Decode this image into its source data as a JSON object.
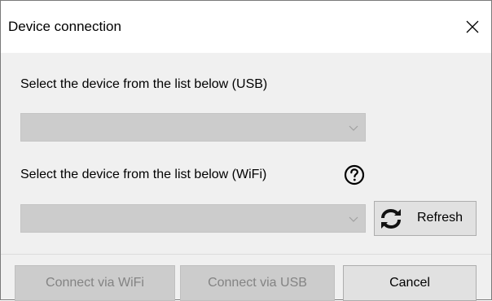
{
  "dialog": {
    "title": "Device connection",
    "close_icon": "close-icon"
  },
  "usb": {
    "label": "Select the device from the list below (USB)",
    "selected_value": "",
    "enabled": false
  },
  "wifi": {
    "label": "Select the device from the list below (WiFi)",
    "help_icon": "question-circle-icon",
    "selected_value": "",
    "enabled": false,
    "refresh_label": "Refresh",
    "refresh_icon": "refresh-icon"
  },
  "footer": {
    "connect_wifi_label": "Connect via WiFi",
    "connect_usb_label": "Connect via USB",
    "cancel_label": "Cancel"
  },
  "colors": {
    "disabled_bg": "#cccccc",
    "disabled_text": "#838383",
    "button_bg": "#e1e1e1",
    "dialog_bg": "#f0f0f0"
  }
}
